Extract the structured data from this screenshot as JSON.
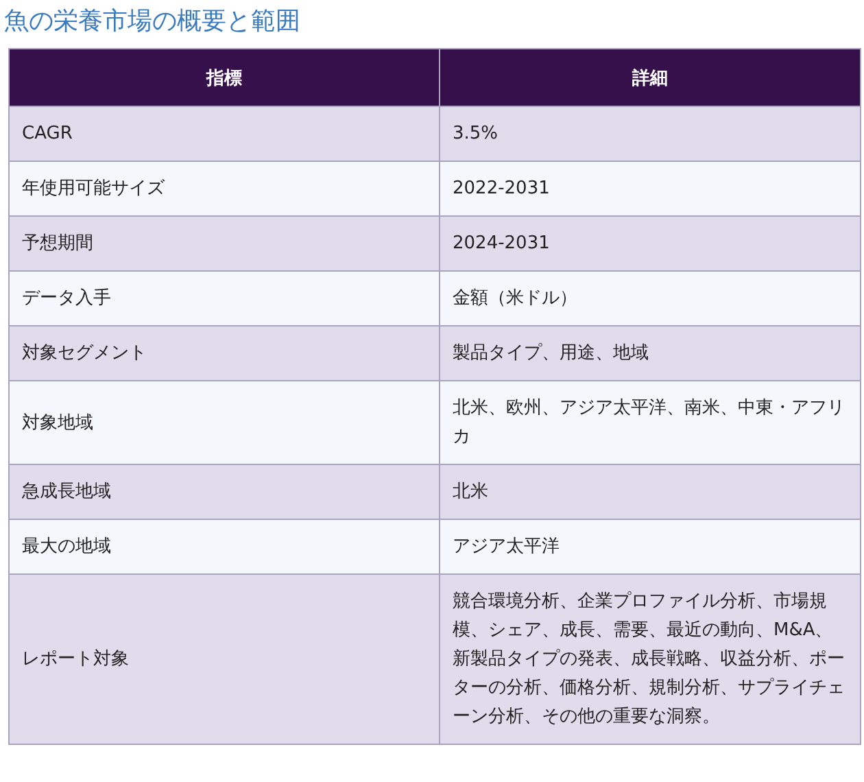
{
  "title": "魚の栄養市場の概要と範囲",
  "table": {
    "columns": [
      "指標",
      "詳細"
    ],
    "rows": [
      [
        "CAGR",
        "3.5%"
      ],
      [
        "年使用可能サイズ",
        "2022-2031"
      ],
      [
        "予想期間",
        "2024-2031"
      ],
      [
        "データ入手",
        "金額（米ドル）"
      ],
      [
        "対象セグメント",
        "製品タイプ、用途、地域"
      ],
      [
        "対象地域",
        "北米、欧州、アジア太平洋、南米、中東・アフリカ"
      ],
      [
        "急成長地域",
        "北米"
      ],
      [
        "最大の地域",
        "アジア太平洋"
      ],
      [
        "レポート対象",
        "競合環境分析、企業プロファイル分析、市場規模、シェア、成長、需要、最近の動向、M&A、新製品タイプの発表、成長戦略、収益分析、ポーターの分析、価格分析、規制分析、サプライチェーン分析、その他の重要な洞察。"
      ]
    ]
  }
}
